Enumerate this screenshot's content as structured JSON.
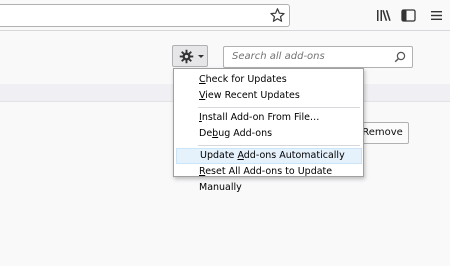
{
  "search": {
    "placeholder": "Search all add-ons"
  },
  "actions": {
    "remove_label": "Remove"
  },
  "menu": {
    "items": [
      {
        "pre": "",
        "key": "C",
        "post": "heck for Updates"
      },
      {
        "pre": "",
        "key": "V",
        "post": "iew Recent Updates"
      },
      {
        "pre": "",
        "key": "I",
        "post": "nstall Add-on From File…"
      },
      {
        "pre": "De",
        "key": "b",
        "post": "ug Add-ons"
      },
      {
        "pre": "Update ",
        "key": "A",
        "post": "dd-ons Automatically"
      },
      {
        "pre": "",
        "key": "R",
        "post": "eset All Add-ons to Update Manually"
      }
    ],
    "highlighted_index": 4
  },
  "icons": {
    "toolbar": [
      "bookmark-star-icon",
      "library-icon",
      "sidebar-icon",
      "hamburger-menu-icon"
    ],
    "tools_button": "gear-icon",
    "search": "magnifier-icon"
  },
  "colors": {
    "menu_highlight": "#e5f1fb",
    "page_bg": "#f9f9fa"
  }
}
